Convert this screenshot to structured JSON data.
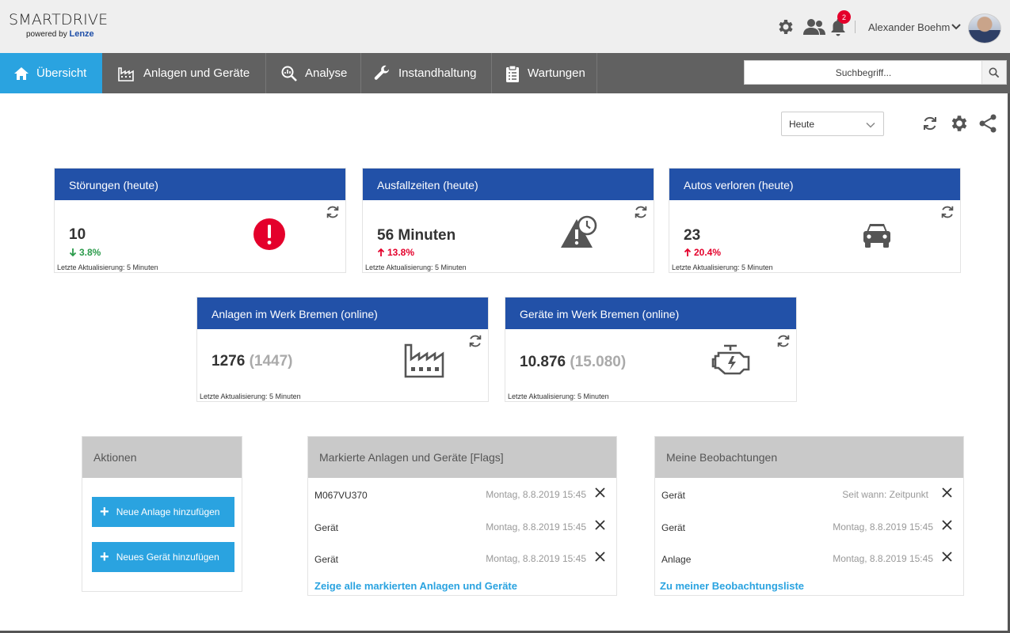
{
  "header": {
    "logo_main": "SMARTDRIVE",
    "logo_sub": "powered by",
    "logo_brand": "Lenze",
    "notification_count": "2",
    "username": "Alexander Boehm",
    "icons": [
      "gear-icon",
      "users-icon",
      "bell-icon",
      "chevron-down-icon"
    ]
  },
  "nav": {
    "items": [
      {
        "label": "Übersicht",
        "icon": "home-icon",
        "active": true
      },
      {
        "label": "Anlagen und Geräte",
        "icon": "factory-icon",
        "active": false
      },
      {
        "label": "Analyse",
        "icon": "analysis-icon",
        "active": false
      },
      {
        "label": "Instandhaltung",
        "icon": "wrench-icon",
        "active": false
      },
      {
        "label": "Wartungen",
        "icon": "clipboard-icon",
        "active": false
      }
    ],
    "search_placeholder": "Suchbegriff..."
  },
  "toolbar": {
    "period_selected": "Heute"
  },
  "kpis": [
    {
      "title": "Störungen (heute)",
      "value": "10",
      "trend": "3.8%",
      "trend_dir": "down",
      "footer": "Letzte Aktualisierung: 5 Minuten",
      "icon": "alert-icon"
    },
    {
      "title": "Ausfallzeiten (heute)",
      "value": "56 Minuten",
      "trend": "13.8%",
      "trend_dir": "up",
      "footer": "Letzte Aktualisierung: 5 Minuten",
      "icon": "warning-clock-icon"
    },
    {
      "title": "Autos verloren (heute)",
      "value": "23",
      "trend": "20.4%",
      "trend_dir": "up",
      "footer": "Letzte Aktualisierung: 5 Minuten",
      "icon": "car-icon"
    },
    {
      "title": "Anlagen im Werk Bremen (online)",
      "value": "1276",
      "total": "(1447)",
      "footer": "Letzte Aktualisierung: 5 Minuten",
      "icon": "factory-icon"
    },
    {
      "title": "Geräte im Werk Bremen (online)",
      "value": "10.876",
      "total": "(15.080)",
      "footer": "Letzte Aktualisierung: 5 Minuten",
      "icon": "engine-icon"
    }
  ],
  "actions": {
    "title": "Aktionen",
    "buttons": [
      "Neue Anlage hinzufügen",
      "Neues Gerät hinzufügen"
    ]
  },
  "flags": {
    "title": "Markierte Anlagen und Geräte [Flags]",
    "rows": [
      {
        "name": "M067VU370",
        "date": "Montag, 8.8.2019 15:45"
      },
      {
        "name": "Gerät",
        "date": "Montag, 8.8.2019 15:45"
      },
      {
        "name": "Gerät",
        "date": "Montag, 8.8.2019 15:45"
      }
    ],
    "link": "Zeige alle markierten Anlagen und Geräte"
  },
  "watch": {
    "title": "Meine Beobachtungen",
    "rows": [
      {
        "name": "Gerät",
        "date": "Seit wann: Zeitpunkt"
      },
      {
        "name": "Gerät",
        "date": "Montag, 8.8.2019 15:45"
      },
      {
        "name": "Anlage",
        "date": "Montag, 8.8.2019 15:45"
      }
    ],
    "link": "Zu meiner Beobachtungsliste"
  },
  "colors": {
    "nav_bg": "#616161",
    "nav_active": "#2aa3e0",
    "card_header": "#2251a8",
    "panel_header": "#c9c9c9",
    "link": "#2aa3e0",
    "trend_up": "#e4002b",
    "trend_down": "#2a9a4a",
    "alert": "#e4002b"
  }
}
